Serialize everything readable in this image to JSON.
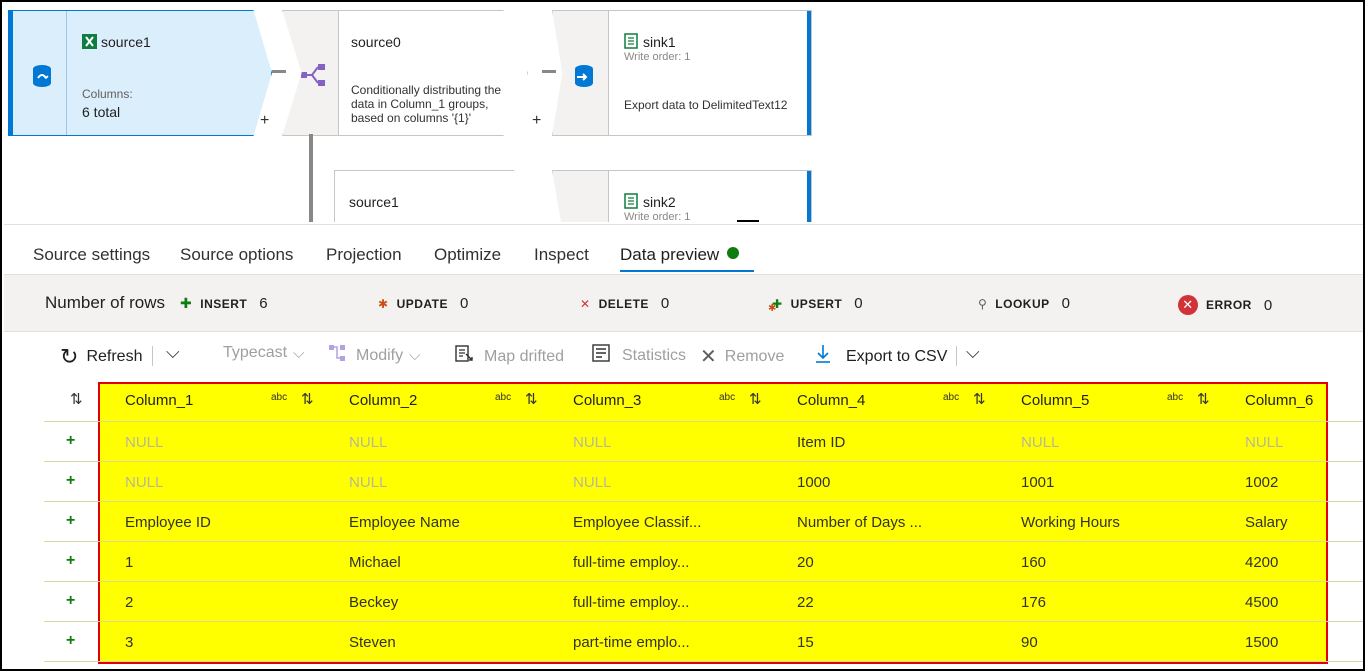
{
  "canvas": {
    "source1": {
      "title": "source1",
      "columns_label": "Columns:",
      "columns_value": "6 total"
    },
    "source0": {
      "title": "source0",
      "desc": "Conditionally distributing the data in Column_1 groups, based on columns '{1}'"
    },
    "sink1": {
      "title": "sink1",
      "write_order": "Write order: 1",
      "desc": "Export data to DelimitedText12"
    },
    "source1b": {
      "title": "source1"
    },
    "sink2": {
      "title": "sink2",
      "write_order": "Write order: 1"
    },
    "plus": "+"
  },
  "tabs": [
    "Source settings",
    "Source options",
    "Projection",
    "Optimize",
    "Inspect",
    "Data preview"
  ],
  "stats": {
    "rows_label": "Number of rows",
    "insert": {
      "label": "INSERT",
      "value": "6"
    },
    "update": {
      "label": "UPDATE",
      "value": "0"
    },
    "delete": {
      "label": "DELETE",
      "value": "0"
    },
    "upsert": {
      "label": "UPSERT",
      "value": "0"
    },
    "lookup": {
      "label": "LOOKUP",
      "value": "0"
    },
    "error": {
      "label": "ERROR",
      "value": "0"
    }
  },
  "toolbar": {
    "refresh": "Refresh",
    "typecast": "Typecast",
    "modify": "Modify",
    "map_drifted": "Map drifted",
    "statistics": "Statistics",
    "remove": "Remove",
    "export": "Export to CSV"
  },
  "grid": {
    "type_label": "abc",
    "headers": [
      "Column_1",
      "Column_2",
      "Column_3",
      "Column_4",
      "Column_5",
      "Column_6"
    ],
    "rows": [
      [
        "NULL",
        "NULL",
        "NULL",
        "Item ID",
        "NULL",
        "NULL"
      ],
      [
        "NULL",
        "NULL",
        "NULL",
        "1000",
        "1001",
        "1002"
      ],
      [
        "Employee ID",
        "Employee Name",
        "Employee Classif...",
        "Number of Days ...",
        "Working Hours",
        "Salary"
      ],
      [
        "1",
        "Michael",
        "full-time employ...",
        "20",
        "160",
        "4200"
      ],
      [
        "2",
        "Beckey",
        "full-time employ...",
        "22",
        "176",
        "4500"
      ],
      [
        "3",
        "Steven",
        "part-time emplo...",
        "15",
        "90",
        "1500"
      ]
    ]
  },
  "colors": {
    "accent": "#0078d4",
    "highlight": "#ffff00",
    "highlight_border": "#e00000",
    "ok": "#107c10",
    "error": "#d13438"
  }
}
